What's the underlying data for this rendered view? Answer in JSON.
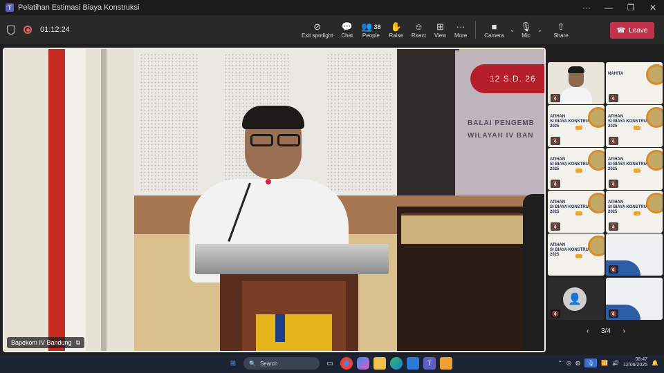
{
  "window": {
    "title": "Pelatihan Estimasi Biaya Konstruksi",
    "controls": [
      "···",
      "—",
      "❐",
      "✕"
    ]
  },
  "meeting": {
    "timer": "01:12:24",
    "toolbar": {
      "exit_spotlight": "Exit spotlight",
      "chat": "Chat",
      "people": "People",
      "people_count": "38",
      "raise": "Raise",
      "react": "React",
      "view": "View",
      "more": "More",
      "camera": "Camera",
      "mic": "Mic",
      "share": "Share",
      "leave": "Leave"
    }
  },
  "stage": {
    "speaker_name": "Bapekom IV Bandung",
    "banner_date": "12 S.D. 26",
    "banner_line1": "BALAI PENGEMB",
    "banner_line2": "WILAYAH IV BAN"
  },
  "gallery": {
    "slide_title": "ATIHAN",
    "slide_subtitle": "SI BIAYA KONSTRUKSI",
    "slide_year": "2025",
    "first_slide_title": "NAHITA",
    "page_indicator": "3/4"
  },
  "taskbar": {
    "search_placeholder": "Search",
    "time": "08:47",
    "date": "12/06/2025"
  }
}
